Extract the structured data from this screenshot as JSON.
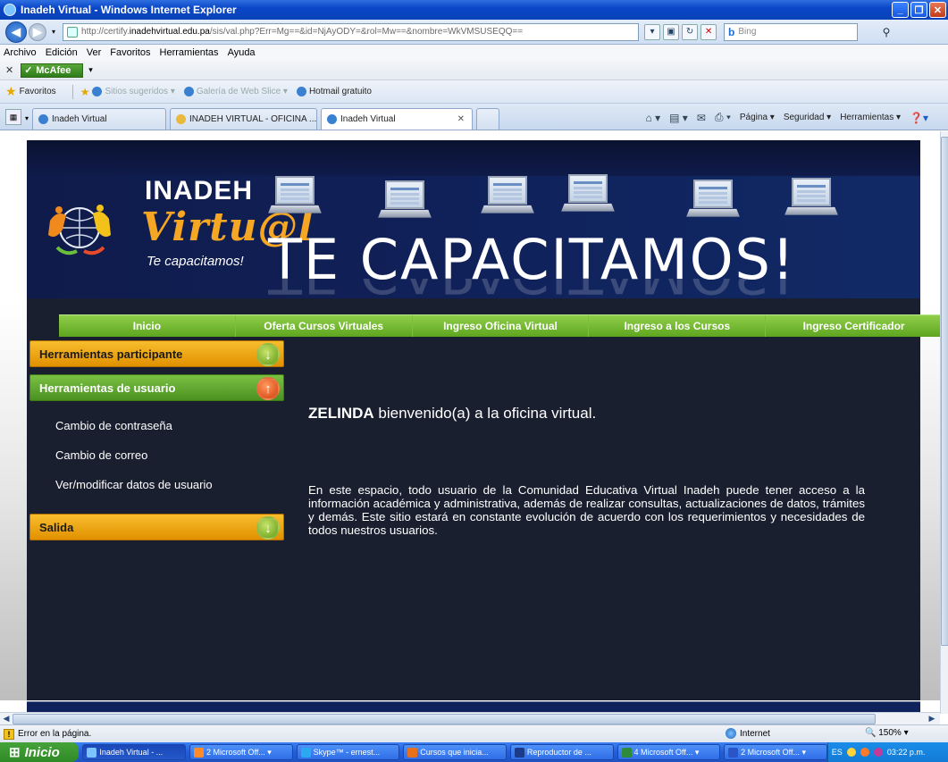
{
  "window": {
    "title": "Inadeh Virtual - Windows Internet Explorer",
    "url_prefix": "http://certify.",
    "url_domain": "inadehvirtual.edu.pa",
    "url_rest": "/sis/val.php?Err=Mg==&id=NjAyODY=&rol=Mw==&nombre=WkVMSUSEQQ==",
    "search_placeholder": "Bing",
    "search_brand": "b"
  },
  "menu": [
    "Archivo",
    "Edición",
    "Ver",
    "Favoritos",
    "Herramientas",
    "Ayuda"
  ],
  "toolbar": {
    "mcafee_label": "McAfee"
  },
  "favorites": {
    "label": "Favoritos",
    "items": [
      "Sitios sugeridos ▾",
      "Galería de Web Slice ▾",
      "Hotmail gratuito"
    ]
  },
  "tabs": [
    {
      "label": "Inadeh Virtual",
      "active": false
    },
    {
      "label": "INADEH VIRTUAL - OFICINA ...",
      "active": false
    },
    {
      "label": "Inadeh Virtual",
      "active": true
    }
  ],
  "commands": [
    "Página ▾",
    "Seguridad ▾",
    "Herramientas ▾"
  ],
  "site": {
    "logo_title": "INADEH",
    "logo_virtual": "Virtu@l",
    "logo_tagline": "Te capacitamos!",
    "banner_slogan": "TE CAPACITAMOS!",
    "nav": [
      "Inicio",
      "Oferta Cursos Virtuales",
      "Ingreso Oficina Virtual",
      "Ingreso a los Cursos",
      "Ingreso Certificador"
    ],
    "sidebar": {
      "participante": "Herramientas participante",
      "usuario": "Herramientas de usuario",
      "links": [
        "Cambio de contraseña",
        "Cambio de correo",
        "Ver/modificar datos de usuario"
      ],
      "salida": "Salida"
    },
    "welcome_name": "ZELINDA",
    "welcome_text": " bienvenido(a) a la oficina virtual.",
    "paragraph": "En este espacio, todo usuario de la Comunidad Educativa Virtual Inadeh puede tener acceso a la información académica y administrativa, además de realizar consultas, actualizaciones de datos, trámites y demás. Este sitio estará en constante evolución de acuerdo con los requerimientos y necesidades de todos nuestros usuarios."
  },
  "status": {
    "text": "Error en la página.",
    "zone": "Internet",
    "zoom": "150%"
  },
  "taskbar": {
    "start": "Inicio",
    "tasks": [
      "Inadeh Virtual - ...",
      "2 Microsoft Off... ▾",
      "Skype™ - ernest...",
      "Cursos que inicia...",
      "Reproductor de ...",
      "4 Microsoft Off... ▾",
      "2 Microsoft Off... ▾"
    ],
    "lang": "ES",
    "clock": "03:22 p.m."
  }
}
